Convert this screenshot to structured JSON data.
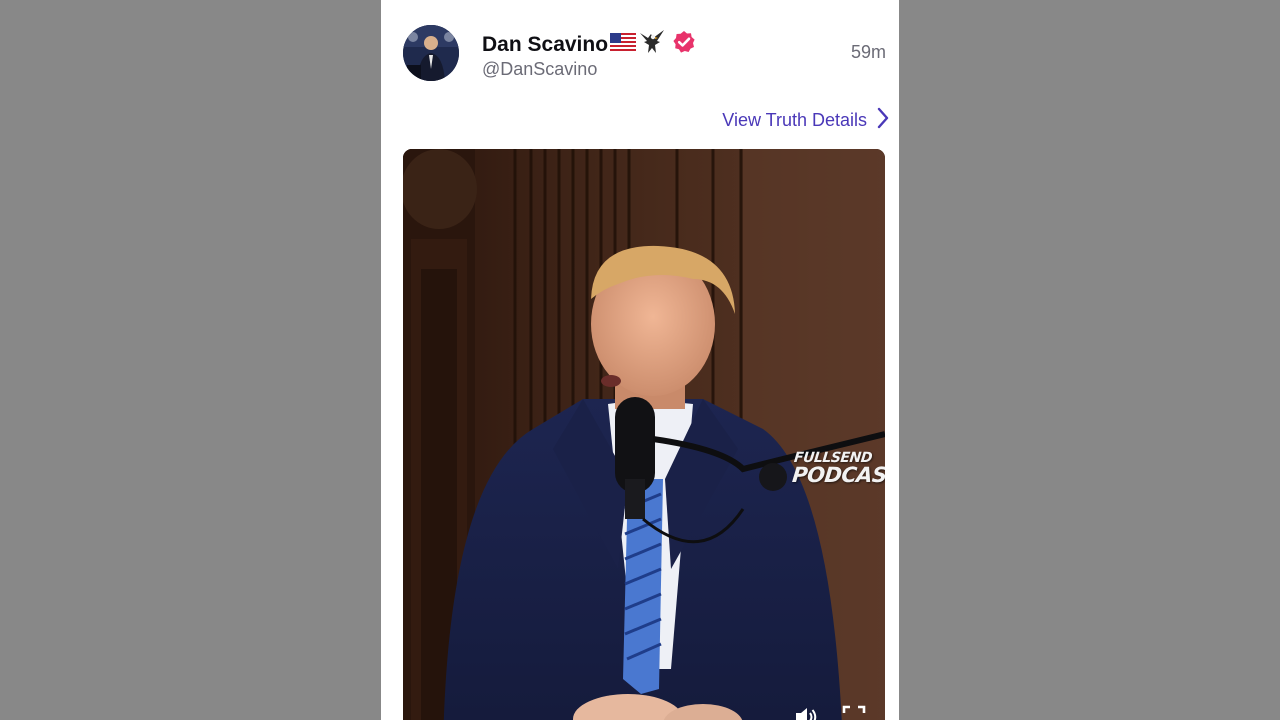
{
  "post": {
    "author": {
      "display_name": "Dan Scavino",
      "handle": "@DanScavino",
      "verified": true,
      "name_emojis": [
        "us-flag-icon",
        "eagle-icon"
      ]
    },
    "timestamp": "59m",
    "view_details_label": "View Truth Details",
    "video": {
      "watermark_top": "FULLSEND",
      "watermark_bottom": "PODCAST",
      "controls": [
        "volume-icon",
        "fullscreen-icon"
      ]
    }
  },
  "colors": {
    "background": "#888888",
    "card": "#ffffff",
    "link": "#4a38b8",
    "verified": "#e8336b",
    "muted_text": "#6b6b76"
  }
}
